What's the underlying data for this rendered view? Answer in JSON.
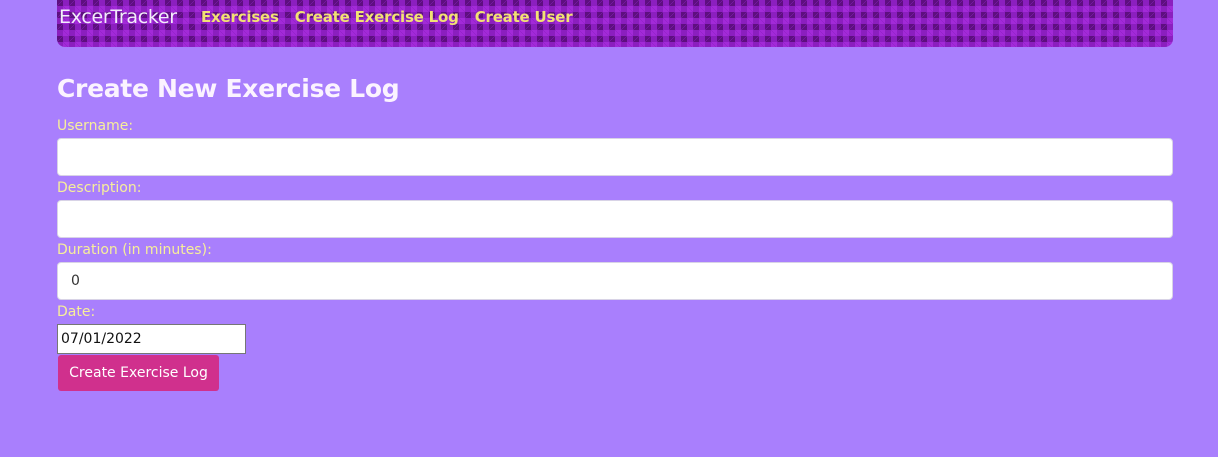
{
  "navbar": {
    "brand": "ExcerTracker",
    "links": [
      {
        "label": "Exercises"
      },
      {
        "label": "Create Exercise Log"
      },
      {
        "label": "Create User"
      }
    ]
  },
  "form": {
    "title": "Create New Exercise Log",
    "username": {
      "label": "Username:",
      "value": ""
    },
    "description": {
      "label": "Description:",
      "value": ""
    },
    "duration": {
      "label": "Duration (in minutes):",
      "value": "0"
    },
    "date": {
      "label": "Date:",
      "value": "07/01/2022"
    },
    "submit_label": "Create Exercise Log"
  },
  "colors": {
    "background": "#a97ffd",
    "navbar": "#8b1fbf",
    "nav_link": "#f2e174",
    "label": "#f7ef9a",
    "button": "#d0308d"
  }
}
